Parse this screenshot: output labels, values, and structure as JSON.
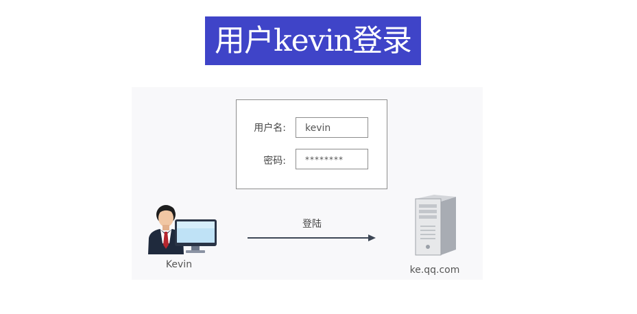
{
  "title": "用户kevin登录",
  "form": {
    "username_label": "用户名:",
    "username_value": "kevin",
    "password_label": "密码:",
    "password_value": "********"
  },
  "arrow": {
    "label": "登陆"
  },
  "user": {
    "name": "Kevin",
    "icon": "user-at-computer-icon"
  },
  "server": {
    "host": "ke.qq.com",
    "icon": "server-tower-icon"
  },
  "colors": {
    "banner": "#3f44c8",
    "banner_text": "#ffffff",
    "arrow": "#3c4654"
  }
}
